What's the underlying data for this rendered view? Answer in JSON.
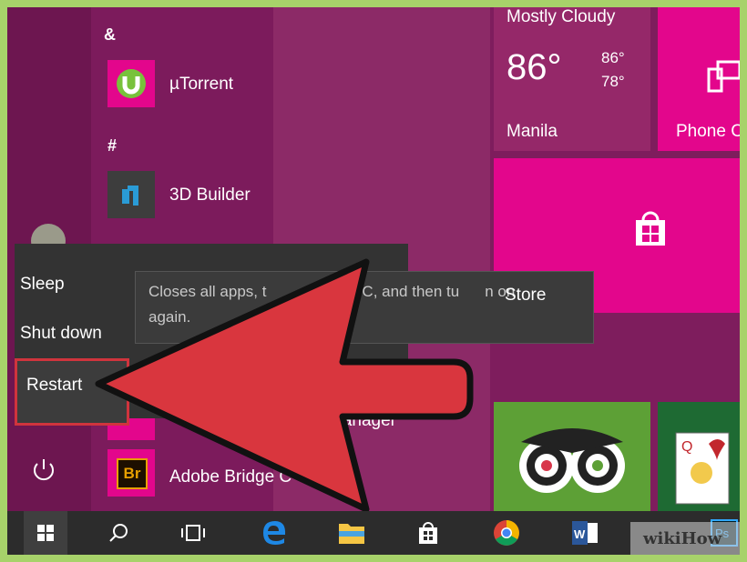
{
  "applist": {
    "sections": [
      {
        "letter": "&",
        "apps": [
          {
            "label": "µTorrent",
            "icon": "utorrent-icon"
          }
        ]
      },
      {
        "letter": "#",
        "apps": [
          {
            "label": "3D Builder",
            "icon": "3d-builder-icon"
          }
        ]
      }
    ],
    "lower_apps": [
      {
        "label": "Adobe Bridge C",
        "icon": "adobe-bridge-icon",
        "badge": "Br"
      }
    ],
    "partial_lower_app": "Manager"
  },
  "power_menu": {
    "items": [
      "Sleep",
      "Shut down",
      "Restart"
    ],
    "highlighted": "Restart",
    "tooltip_line1": "Closes all apps, t",
    "tooltip_line1_right": "ne PC, and then tu",
    "tooltip_line1_end": "n on",
    "tooltip_line2": "again."
  },
  "tiles": {
    "weather": {
      "condition": "Mostly Cloudy",
      "temp": "86°",
      "high": "86°",
      "low": "78°",
      "city": "Manila"
    },
    "phone": {
      "label": "Phone Co"
    },
    "store": {
      "label": "Store"
    }
  },
  "taskbar": {
    "items": [
      "start-icon",
      "search-icon",
      "task-view-icon",
      "edge-icon",
      "file-explorer-icon",
      "store-icon",
      "chrome-icon",
      "word-icon",
      "photoshop-icon"
    ]
  },
  "watermark": "wikiHow",
  "colors": {
    "frame": "#a7d26a",
    "start_bg": "#7a1b5a",
    "tile_magenta": "#e3068c",
    "tile_dark": "#952869",
    "tripadvisor": "#5da036",
    "arrow": "#d9363e",
    "taskbar": "#2c2c2c"
  }
}
